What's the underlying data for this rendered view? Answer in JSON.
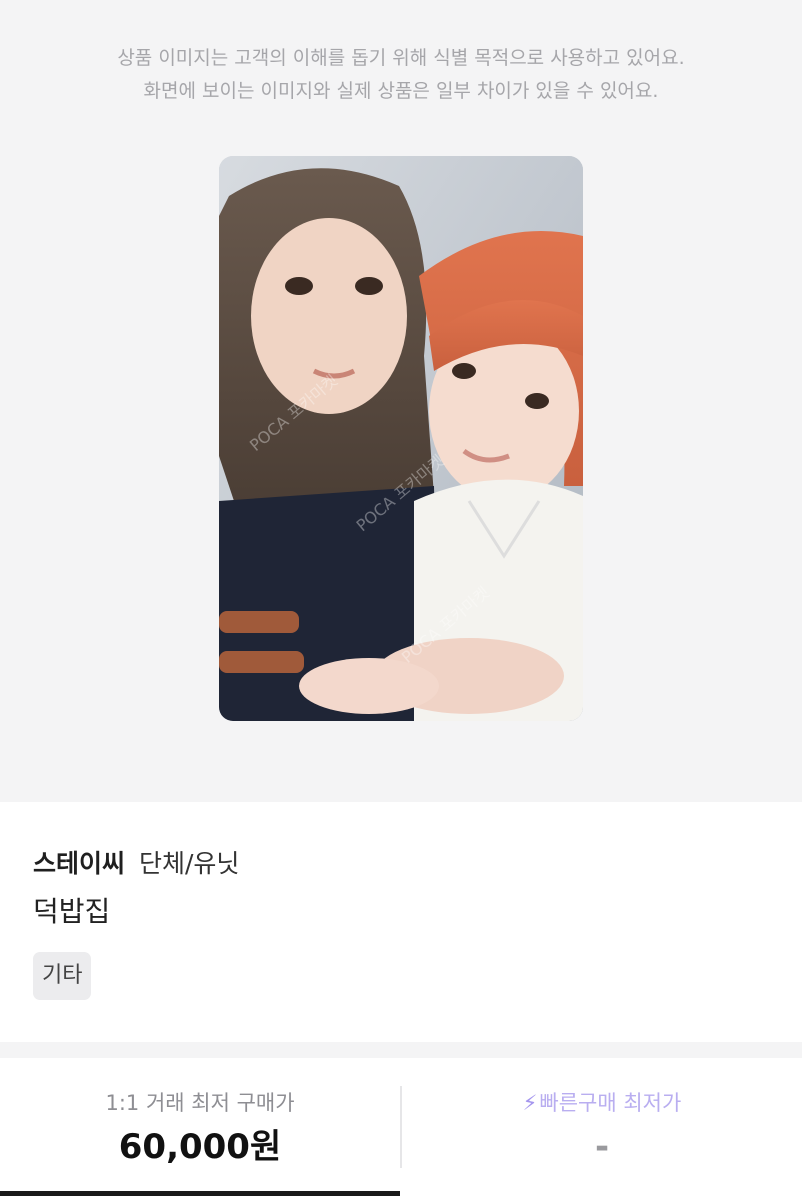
{
  "notice": {
    "line1": "상품 이미지는 고객의 이해를 돕기 위해 식별 목적으로 사용하고 있어요.",
    "line2": "화면에 보이는 이미지와 실제 상품은 일부 차이가 있을 수 있어요."
  },
  "product": {
    "group_name": "스테이씨",
    "group_type": "단체/유닛",
    "name": "덕밥집",
    "category": "기타"
  },
  "prices": {
    "one_to_one_label": "1:1 거래 최저 구매가",
    "one_to_one_value": "60,000원",
    "fast_label": "빠른구매 최저가",
    "fast_value": "-"
  },
  "icons": {
    "fast_icon": "lightning-bolt-icon"
  }
}
